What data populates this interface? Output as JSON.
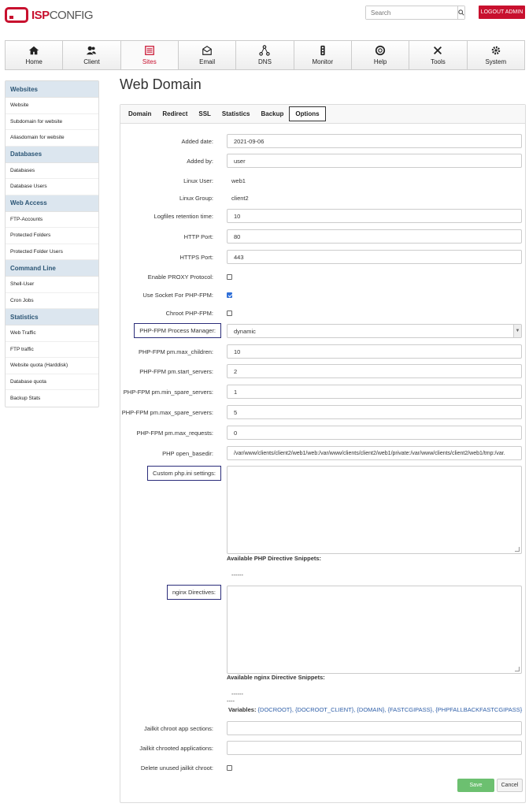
{
  "header": {
    "logo_bold": "ISP",
    "logo_light": "CONFIG",
    "search_placeholder": "Search",
    "logout": "LOGOUT ADMIN"
  },
  "nav": [
    {
      "label": "Home",
      "icon": "home-icon"
    },
    {
      "label": "Client",
      "icon": "users-icon"
    },
    {
      "label": "Sites",
      "icon": "list-icon"
    },
    {
      "label": "Email",
      "icon": "mail-icon"
    },
    {
      "label": "DNS",
      "icon": "network-icon"
    },
    {
      "label": "Monitor",
      "icon": "traffic-light-icon"
    },
    {
      "label": "Help",
      "icon": "lifebuoy-icon"
    },
    {
      "label": "Tools",
      "icon": "tools-icon"
    },
    {
      "label": "System",
      "icon": "gear-icon"
    }
  ],
  "sidebar": {
    "groups": [
      {
        "title": "Websites",
        "items": [
          "Website",
          "Subdomain for website",
          "Aliasdomain for website"
        ]
      },
      {
        "title": "Databases",
        "items": [
          "Databases",
          "Database Users"
        ]
      },
      {
        "title": "Web Access",
        "items": [
          "FTP-Accounts",
          "Protected Folders",
          "Protected Folder Users"
        ]
      },
      {
        "title": "Command Line",
        "items": [
          "Shell-User",
          "Cron Jobs"
        ]
      },
      {
        "title": "Statistics",
        "items": [
          "Web Traffic",
          "FTP traffic",
          "Website quota (Harddisk)",
          "Database quota",
          "Backup Stats"
        ]
      }
    ]
  },
  "page_title": "Web Domain",
  "tabs": [
    "Domain",
    "Redirect",
    "SSL",
    "Statistics",
    "Backup",
    "Options"
  ],
  "form": {
    "added_date_label": "Added date:",
    "added_date": "2021-09-06",
    "added_by_label": "Added by:",
    "added_by": "user",
    "linux_user_label": "Linux User:",
    "linux_user": "web1",
    "linux_group_label": "Linux Group:",
    "linux_group": "client2",
    "logfiles_label": "Logfiles retention time:",
    "logfiles": "10",
    "http_port_label": "HTTP Port:",
    "http_port": "80",
    "https_port_label": "HTTPS Port:",
    "https_port": "443",
    "proxy_label": "Enable PROXY Protocol:",
    "proxy_checked": false,
    "socket_label": "Use Socket For PHP-FPM:",
    "socket_checked": true,
    "chroot_label": "Chroot PHP-FPM:",
    "chroot_checked": false,
    "pm_label": "PHP-FPM Process Manager:",
    "pm_value": "dynamic",
    "max_children_label": "PHP-FPM pm.max_children:",
    "max_children": "10",
    "start_servers_label": "PHP-FPM pm.start_servers:",
    "start_servers": "2",
    "min_spare_label": "PHP-FPM pm.min_spare_servers:",
    "min_spare": "1",
    "max_spare_label": "PHP-FPM pm.max_spare_servers:",
    "max_spare": "5",
    "max_requests_label": "PHP-FPM pm.max_requests:",
    "max_requests": "0",
    "basedir_label": "PHP open_basedir:",
    "basedir": "/var/www/clients/client2/web1/web:/var/www/clients/client2/web1/private:/var/www/clients/client2/web1/tmp:/var.",
    "custom_php_label": "Custom php.ini settings:",
    "php_snippets_label": "Available PHP Directive Snippets:",
    "php_snippets_value": "------",
    "nginx_label": "nginx Directives:",
    "nginx_snippets_label": "Available nginx Directive Snippets:",
    "nginx_snippets_value": "------",
    "nginx_snippets_value2": "----",
    "variables_label": "Variables:",
    "variables": "{DOCROOT}, {DOCROOT_CLIENT}, {DOMAIN}, {FASTCGIPASS}, {PHPFALLBACKFASTCGIPASS}",
    "jailkit_sections_label": "Jailkit chroot app sections:",
    "jailkit_apps_label": "Jailkit chrooted applications:",
    "delete_jailkit_label": "Delete unused jailkit chroot:",
    "delete_jailkit_checked": false
  },
  "buttons": {
    "save": "Save",
    "cancel": "Cancel"
  }
}
